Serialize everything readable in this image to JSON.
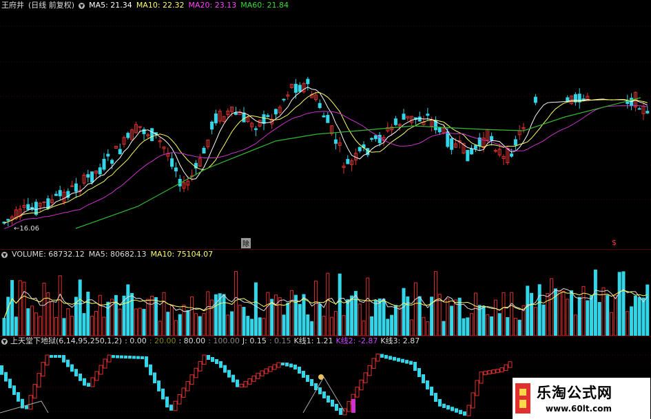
{
  "price_panel": {
    "title": "王府井",
    "period": "(日线 前复权)",
    "indicators": [
      {
        "label": "MA5: 21.34",
        "color": "#ffffff"
      },
      {
        "label": "MA10: 22.32",
        "color": "#ffff66"
      },
      {
        "label": "MA20: 23.13",
        "color": "#ff44ff"
      },
      {
        "label": "MA60: 21.84",
        "color": "#33dd33"
      }
    ],
    "low_marker": "←16.06",
    "markers": [
      "除",
      "$"
    ]
  },
  "volume_panel": {
    "indicators": [
      {
        "label": "VOLUME: 68732.12",
        "color": "#dddddd"
      },
      {
        "label": "MA5: 80682.13",
        "color": "#dddddd"
      },
      {
        "label": "MA10: 75104.07",
        "color": "#ffff66"
      }
    ]
  },
  "indicator_panel": {
    "formula": "上天堂下地狱(6,14,95,250,1,2)",
    "indicators": [
      {
        "label": ": 0.00",
        "color": "#dddddd"
      },
      {
        "label": ": 20.00",
        "color": "#888800"
      },
      {
        "label": ": 80.00",
        "color": "#dddddd"
      },
      {
        "label": ": 100.00",
        "color": "#888888"
      },
      {
        "label": "J: 0.15",
        "color": "#dddddd"
      },
      {
        "label": ": 0.15",
        "color": "#888888"
      },
      {
        "label": "K线1: 1.21",
        "color": "#dddddd"
      },
      {
        "label": "K线2: -2.87",
        "color": "#cc44ff"
      },
      {
        "label": "K线3: 2.87",
        "color": "#dddddd"
      }
    ]
  },
  "watermark": {
    "title": "乐淘公式网",
    "url": "www.60lt.com"
  },
  "colors": {
    "up": "#e03030",
    "down": "#33d6e8",
    "ma5": "#ffffff",
    "ma10": "#ffff66",
    "ma20": "#cc33cc",
    "ma60": "#33bb33"
  }
}
